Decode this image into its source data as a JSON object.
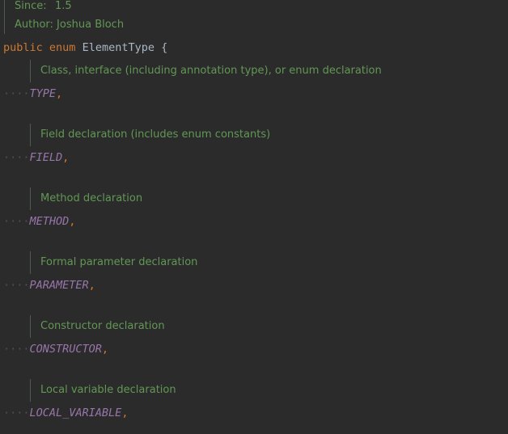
{
  "header_doc": {
    "since_label": "Since:",
    "since_value": "1.5",
    "author": "Author: Joshua Bloch"
  },
  "declaration": {
    "keyword_public": "public",
    "keyword_enum": "enum",
    "name": "ElementType",
    "open_brace": "{"
  },
  "indent_dots": "····",
  "comma": ",",
  "constants": [
    {
      "doc": "Class, interface (including annotation type), or enum declaration",
      "name": "TYPE"
    },
    {
      "doc": "Field declaration (includes enum constants)",
      "name": "FIELD"
    },
    {
      "doc": "Method declaration",
      "name": "METHOD"
    },
    {
      "doc": "Formal parameter declaration",
      "name": "PARAMETER"
    },
    {
      "doc": "Constructor declaration",
      "name": "CONSTRUCTOR"
    },
    {
      "doc": "Local variable declaration",
      "name": "LOCAL_VARIABLE"
    }
  ]
}
